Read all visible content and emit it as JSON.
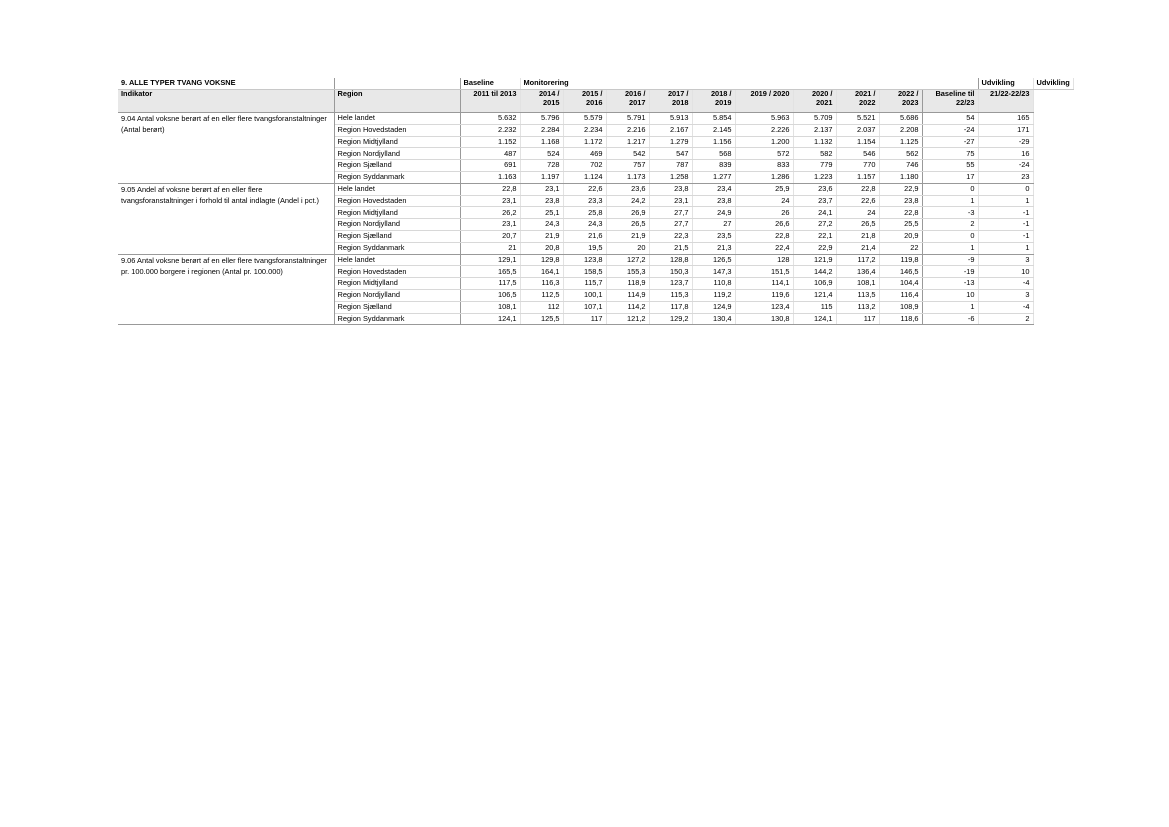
{
  "title": "9. ALLE TYPER TVANG VOKSNE",
  "header_top": {
    "baseline": "Baseline",
    "monitoring": "Monitorering",
    "udvikling1": "Udvikling",
    "udvikling2": "Udvikling"
  },
  "columns": {
    "indikator": "Indikator",
    "region": "Region",
    "periods": [
      {
        "a": "2011 til 2013",
        "b": ""
      },
      {
        "a": "2014 /",
        "b": "2015"
      },
      {
        "a": "2015 /",
        "b": "2016"
      },
      {
        "a": "2016 /",
        "b": "2017"
      },
      {
        "a": "2017 /",
        "b": "2018"
      },
      {
        "a": "2018 /",
        "b": "2019"
      },
      {
        "a": "2019 / 2020",
        "b": ""
      },
      {
        "a": "2020 /",
        "b": "2021"
      },
      {
        "a": "2021 /",
        "b": "2022"
      },
      {
        "a": "2022 /",
        "b": "2023"
      },
      {
        "a": "Baseline til",
        "b": "22/23"
      },
      {
        "a": "21/22-22/23",
        "b": ""
      }
    ]
  },
  "groups": [
    {
      "indicator": "9.04 Antal voksne berørt af en eller flere tvangsforanstaltninger (Antal berørt)",
      "rows": [
        {
          "region": "Hele landet",
          "values": [
            "5.632",
            "5.796",
            "5.579",
            "5.791",
            "5.913",
            "5.854",
            "5.963",
            "5.709",
            "5.521",
            "5.686",
            "54",
            "165"
          ]
        },
        {
          "region": "Region Hovedstaden",
          "values": [
            "2.232",
            "2.284",
            "2.234",
            "2.216",
            "2.167",
            "2.145",
            "2.226",
            "2.137",
            "2.037",
            "2.208",
            "-24",
            "171"
          ]
        },
        {
          "region": "Region Midtjylland",
          "values": [
            "1.152",
            "1.168",
            "1.172",
            "1.217",
            "1.279",
            "1.156",
            "1.200",
            "1.132",
            "1.154",
            "1.125",
            "-27",
            "-29"
          ]
        },
        {
          "region": "Region Nordjylland",
          "values": [
            "487",
            "524",
            "469",
            "542",
            "547",
            "568",
            "572",
            "582",
            "546",
            "562",
            "75",
            "16"
          ]
        },
        {
          "region": "Region Sjælland",
          "values": [
            "691",
            "728",
            "702",
            "757",
            "787",
            "839",
            "833",
            "779",
            "770",
            "746",
            "55",
            "-24"
          ]
        },
        {
          "region": "Region Syddanmark",
          "values": [
            "1.163",
            "1.197",
            "1.124",
            "1.173",
            "1.258",
            "1.277",
            "1.286",
            "1.223",
            "1.157",
            "1.180",
            "17",
            "23"
          ]
        }
      ]
    },
    {
      "indicator": "9.05 Andel af voksne berørt af en eller flere tvangsforanstaltninger i forhold til antal indlagte (Andel i pct.)",
      "rows": [
        {
          "region": "Hele landet",
          "values": [
            "22,8",
            "23,1",
            "22,6",
            "23,6",
            "23,8",
            "23,4",
            "25,9",
            "23,6",
            "22,8",
            "22,9",
            "0",
            "0"
          ]
        },
        {
          "region": "Region Hovedstaden",
          "values": [
            "23,1",
            "23,8",
            "23,3",
            "24,2",
            "23,1",
            "23,8",
            "24",
            "23,7",
            "22,6",
            "23,8",
            "1",
            "1"
          ]
        },
        {
          "region": "Region Midtjylland",
          "values": [
            "26,2",
            "25,1",
            "25,8",
            "26,9",
            "27,7",
            "24,9",
            "26",
            "24,1",
            "24",
            "22,8",
            "-3",
            "-1"
          ]
        },
        {
          "region": "Region Nordjylland",
          "values": [
            "23,1",
            "24,3",
            "24,3",
            "26,5",
            "27,7",
            "27",
            "26,6",
            "27,2",
            "26,5",
            "25,5",
            "2",
            "-1"
          ]
        },
        {
          "region": "Region Sjælland",
          "values": [
            "20,7",
            "21,9",
            "21,6",
            "21,9",
            "22,3",
            "23,5",
            "22,8",
            "22,1",
            "21,8",
            "20,9",
            "0",
            "-1"
          ]
        },
        {
          "region": "Region Syddanmark",
          "values": [
            "21",
            "20,8",
            "19,5",
            "20",
            "21,5",
            "21,3",
            "22,4",
            "22,9",
            "21,4",
            "22",
            "1",
            "1"
          ]
        }
      ]
    },
    {
      "indicator": "9.06 Antal voksne berørt af en eller flere tvangsforanstaltninger pr. 100.000 borgere i regionen (Antal pr. 100.000)",
      "rows": [
        {
          "region": "Hele landet",
          "values": [
            "129,1",
            "129,8",
            "123,8",
            "127,2",
            "128,8",
            "126,5",
            "128",
            "121,9",
            "117,2",
            "119,8",
            "-9",
            "3"
          ]
        },
        {
          "region": "Region Hovedstaden",
          "values": [
            "165,5",
            "164,1",
            "158,5",
            "155,3",
            "150,3",
            "147,3",
            "151,5",
            "144,2",
            "136,4",
            "146,5",
            "-19",
            "10"
          ]
        },
        {
          "region": "Region Midtjylland",
          "values": [
            "117,5",
            "116,3",
            "115,7",
            "118,9",
            "123,7",
            "110,8",
            "114,1",
            "106,9",
            "108,1",
            "104,4",
            "-13",
            "-4"
          ]
        },
        {
          "region": "Region Nordjylland",
          "values": [
            "106,5",
            "112,5",
            "100,1",
            "114,9",
            "115,3",
            "119,2",
            "119,6",
            "121,4",
            "113,5",
            "116,4",
            "10",
            "3"
          ]
        },
        {
          "region": "Region Sjælland",
          "values": [
            "108,1",
            "112",
            "107,1",
            "114,2",
            "117,8",
            "124,9",
            "123,4",
            "115",
            "113,2",
            "108,9",
            "1",
            "-4"
          ]
        },
        {
          "region": "Region Syddanmark",
          "values": [
            "124,1",
            "125,5",
            "117",
            "121,2",
            "129,2",
            "130,4",
            "130,8",
            "124,1",
            "117",
            "118,6",
            "-6",
            "2"
          ]
        }
      ]
    }
  ]
}
